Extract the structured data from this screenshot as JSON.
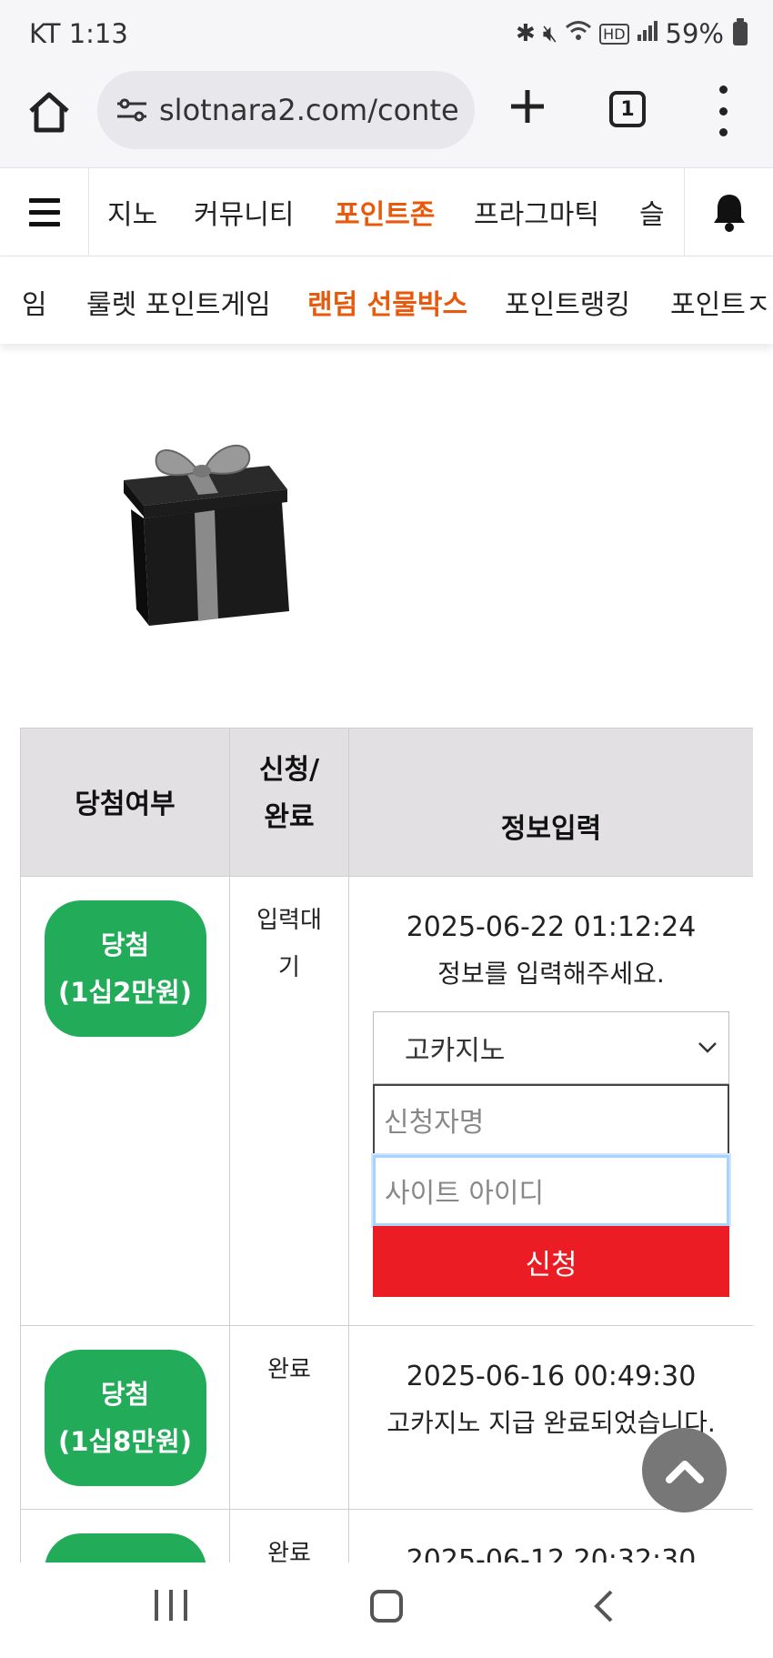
{
  "status_bar": {
    "carrier_time": "KT 1:13",
    "battery": "59%",
    "icons": [
      "bluetooth-icon",
      "mute-icon",
      "wifi-icon",
      "hd-icon",
      "signal-icon",
      "battery-icon"
    ]
  },
  "browser": {
    "url": "slotnara2.com/conte",
    "tab_count": "1"
  },
  "main_nav": {
    "items": [
      {
        "label": "지노",
        "active": false
      },
      {
        "label": "커뮤니티",
        "active": false
      },
      {
        "label": "포인트존",
        "active": true
      },
      {
        "label": "프라그마틱",
        "active": false
      },
      {
        "label": "슬",
        "active": false
      }
    ]
  },
  "sub_nav": {
    "items": [
      {
        "label": "임",
        "active": false
      },
      {
        "label": "룰렛 포인트게임",
        "active": false
      },
      {
        "label": "랜덤 선물박스",
        "active": true
      },
      {
        "label": "포인트랭킹",
        "active": false
      },
      {
        "label": "포인트ㅈ",
        "active": false
      }
    ]
  },
  "table": {
    "headers": {
      "result": "당첨여부",
      "status_line1": "신청/",
      "status_line2": "완료",
      "info": "정보입력"
    },
    "rows": [
      {
        "badge_line1": "당첨",
        "badge_line2": "(1십2만원)",
        "status_line1": "입력대",
        "status_line2": "기",
        "date": "2025-06-22 01:12:24",
        "message": "정보를 입력해주세요.",
        "form": {
          "select_value": "고카지노",
          "name_placeholder": "신청자명",
          "id_placeholder": "사이트 아이디",
          "submit_label": "신청"
        }
      },
      {
        "badge_line1": "당첨",
        "badge_line2": "(1십8만원)",
        "status": "완료",
        "date": "2025-06-16 00:49:30",
        "message": "고카지노 지급 완료되었습니다."
      },
      {
        "badge_line1": "",
        "status": "완료",
        "date": "2025-06-12 20:32:30"
      }
    ]
  },
  "colors": {
    "accent_orange": "#e8590c",
    "badge_green": "#22ab58",
    "submit_red": "#ec1c24",
    "header_gray": "#e2e0e2"
  }
}
